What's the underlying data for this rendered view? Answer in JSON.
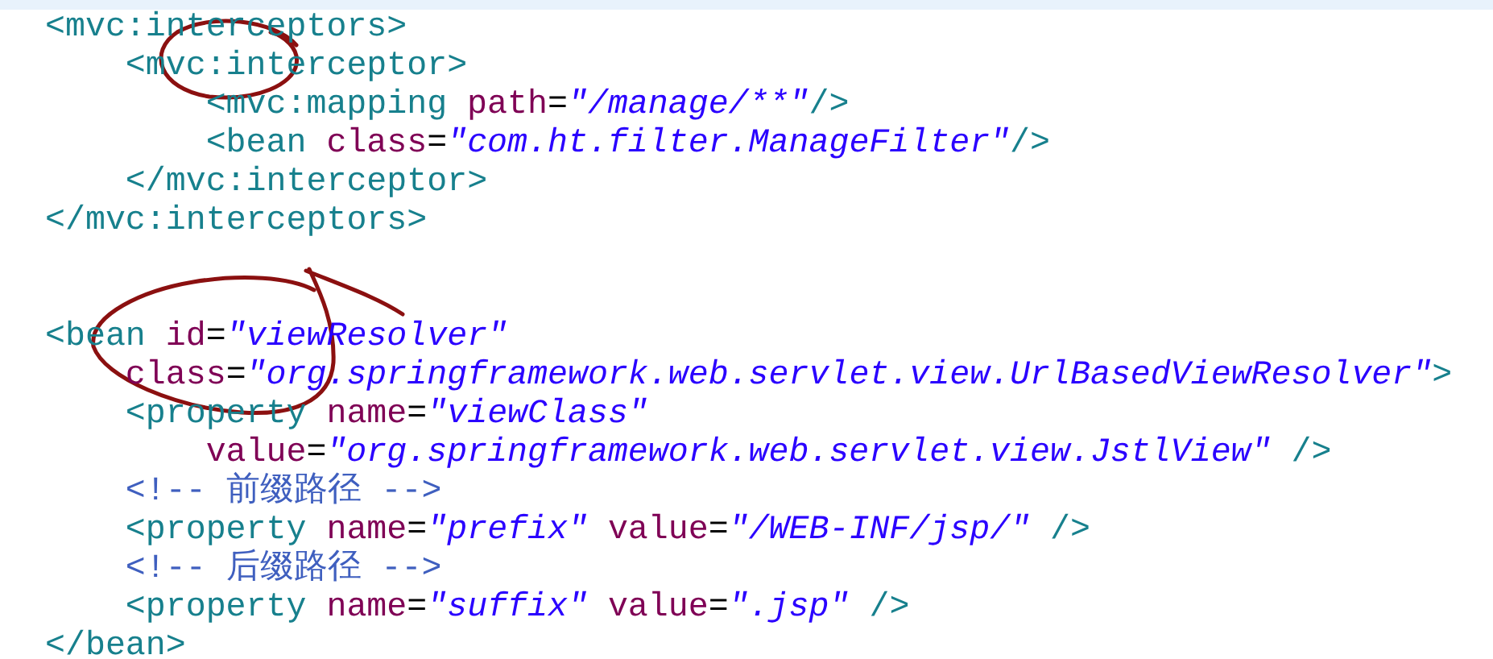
{
  "editor": {
    "lines": [
      {
        "kind": "code",
        "tokens": [
          {
            "kind": "tag",
            "text": "<mvc:interceptors>"
          }
        ],
        "children": [
          {
            "kind": "code",
            "tokens": [
              {
                "kind": "tag",
                "text": "<mvc:interceptor>"
              }
            ],
            "children": [
              {
                "kind": "code",
                "tokens": [
                  {
                    "kind": "tag",
                    "text": "<mvc:mapping"
                  },
                  {
                    "kind": "attr",
                    "text": " path"
                  },
                  {
                    "kind": "eq",
                    "text": "="
                  },
                  {
                    "kind": "value",
                    "text": "\"/manage/**\""
                  },
                  {
                    "kind": "tag",
                    "text": "/>"
                  }
                ]
              },
              {
                "kind": "code",
                "tokens": [
                  {
                    "kind": "tag",
                    "text": "<bean"
                  },
                  {
                    "kind": "attr",
                    "text": " class"
                  },
                  {
                    "kind": "eq",
                    "text": "="
                  },
                  {
                    "kind": "value",
                    "text": "\"com.ht.filter.ManageFilter\""
                  },
                  {
                    "kind": "tag",
                    "text": "/>"
                  }
                ]
              }
            ]
          },
          {
            "kind": "code",
            "tokens": [
              {
                "kind": "tag",
                "text": "</mvc:interceptor>"
              }
            ]
          }
        ]
      },
      {
        "kind": "code",
        "tokens": [
          {
            "kind": "tag",
            "text": "</mvc:interceptors>"
          }
        ]
      },
      {
        "kind": "blank"
      },
      {
        "kind": "blank"
      },
      {
        "kind": "code",
        "tokens": [
          {
            "kind": "tag",
            "text": "<bean"
          },
          {
            "kind": "attr",
            "text": " id"
          },
          {
            "kind": "eq",
            "text": "="
          },
          {
            "kind": "value",
            "text": "\"viewResolver\""
          }
        ],
        "children": [
          {
            "kind": "code",
            "tokens": [
              {
                "kind": "attr",
                "text": "class"
              },
              {
                "kind": "eq",
                "text": "="
              },
              {
                "kind": "value",
                "text": "\"org.springframework.web.servlet.view.UrlBasedViewResolver\""
              },
              {
                "kind": "tag",
                "text": ">"
              }
            ]
          },
          {
            "kind": "code",
            "tokens": [
              {
                "kind": "tag",
                "text": "<property"
              },
              {
                "kind": "attr",
                "text": " name"
              },
              {
                "kind": "eq",
                "text": "="
              },
              {
                "kind": "value",
                "text": "\"viewClass\""
              }
            ],
            "children": [
              {
                "kind": "code",
                "tokens": [
                  {
                    "kind": "attr",
                    "text": "value"
                  },
                  {
                    "kind": "eq",
                    "text": "="
                  },
                  {
                    "kind": "value",
                    "text": "\"org.springframework.web.servlet.view.JstlView\""
                  },
                  {
                    "kind": "tag",
                    "text": " />"
                  }
                ]
              }
            ]
          },
          {
            "kind": "code",
            "tokens": [
              {
                "kind": "comment",
                "text": "<!-- 前缀路径 -->"
              }
            ]
          },
          {
            "kind": "code",
            "tokens": [
              {
                "kind": "tag",
                "text": "<property"
              },
              {
                "kind": "attr",
                "text": " name"
              },
              {
                "kind": "eq",
                "text": "="
              },
              {
                "kind": "value",
                "text": "\"prefix\""
              },
              {
                "kind": "attr",
                "text": " value"
              },
              {
                "kind": "eq",
                "text": "="
              },
              {
                "kind": "value",
                "text": "\"/WEB-INF/jsp/\""
              },
              {
                "kind": "tag",
                "text": " />"
              }
            ]
          },
          {
            "kind": "code",
            "tokens": [
              {
                "kind": "comment",
                "text": "<!-- 后缀路径 -->"
              }
            ]
          },
          {
            "kind": "code",
            "tokens": [
              {
                "kind": "tag",
                "text": "<property"
              },
              {
                "kind": "attr",
                "text": " name"
              },
              {
                "kind": "eq",
                "text": "="
              },
              {
                "kind": "value",
                "text": "\"suffix\""
              },
              {
                "kind": "attr",
                "text": " value"
              },
              {
                "kind": "eq",
                "text": "="
              },
              {
                "kind": "value",
                "text": "\".jsp\""
              },
              {
                "kind": "tag",
                "text": " />"
              }
            ]
          }
        ]
      },
      {
        "kind": "code",
        "tokens": [
          {
            "kind": "tag",
            "text": "</bean>"
          }
        ]
      }
    ]
  }
}
